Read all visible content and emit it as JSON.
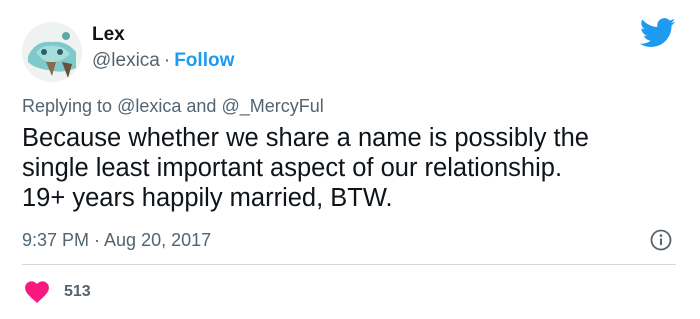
{
  "author": {
    "display_name": "Lex",
    "handle": "@lexica",
    "separator": "·",
    "follow_label": "Follow"
  },
  "reply": {
    "prefix": "Replying to",
    "mention_1": "@lexica",
    "conjunction": "and",
    "mention_2": "@_MercyFul"
  },
  "tweet": {
    "lines": [
      "Because whether we share a name is possibly the",
      "single least important aspect of our relationship.",
      "19+ years happily married, BTW."
    ],
    "timestamp": "9:37 PM · Aug 20, 2017"
  },
  "engagement": {
    "likes": "513"
  },
  "icons": {
    "brand": "twitter-bird-icon",
    "info": "info-icon",
    "like": "heart-icon"
  },
  "colors": {
    "twitter_blue": "#1d9bf0",
    "like_red": "#f91880",
    "secondary_text": "#536471",
    "primary_text": "#0f1419",
    "divider": "#cfd9de"
  }
}
